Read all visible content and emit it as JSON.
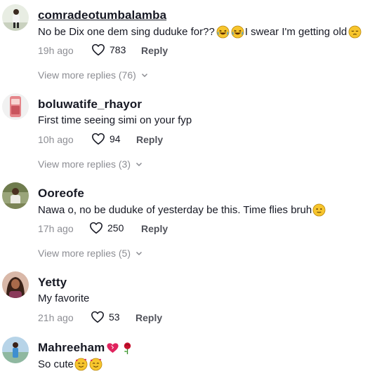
{
  "comments": [
    {
      "username": "comradeotumbalamba",
      "text": "No be Dix one dem sing duduke for??",
      "text_after": "I swear I'm getting old",
      "time": "19h ago",
      "likes": "783",
      "reply_label": "Reply",
      "view_more": "View more replies (76)"
    },
    {
      "username": "boluwatife_rhayor",
      "text": "First time seeing simi on your fyp",
      "time": "10h ago",
      "likes": "94",
      "reply_label": "Reply",
      "view_more": "View more replies (3)"
    },
    {
      "username": "Ooreofe",
      "text": "Nawa o, no be duduke of yesterday be this. Time flies bruh",
      "time": "17h ago",
      "likes": "250",
      "reply_label": "Reply",
      "view_more": "View more replies (5)"
    },
    {
      "username": "Yetty",
      "text": "My favorite",
      "time": "21h ago",
      "likes": "53",
      "reply_label": "Reply"
    },
    {
      "username": "Mahreeham",
      "text": "So cute"
    }
  ],
  "icons": {
    "like": "heart-outline-icon",
    "expand": "chevron-down-icon",
    "emojis": [
      "laughing-emoji",
      "pensive-emoji",
      "slightly-smiling-emoji",
      "heart-emoji",
      "rose-emoji",
      "smiling-hearts-emoji"
    ]
  }
}
